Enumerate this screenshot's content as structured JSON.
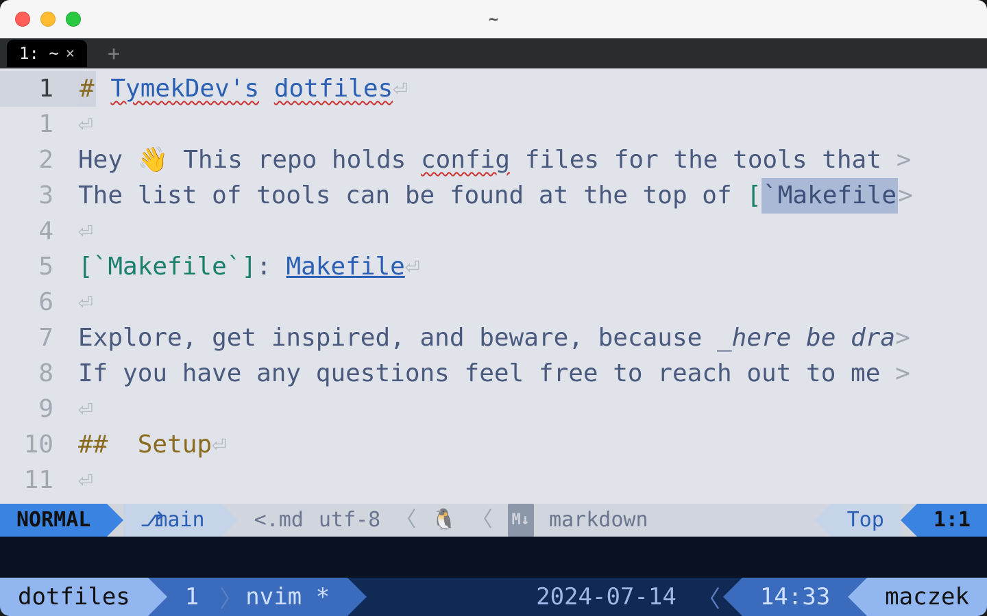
{
  "window": {
    "title": "~"
  },
  "termtabs": {
    "active": {
      "label": "1: ~",
      "close": "×"
    },
    "newtab_glyph": "+"
  },
  "editor": {
    "lines": [
      {
        "gutter": "1",
        "current": true
      },
      {
        "gutter": "1"
      },
      {
        "gutter": "2"
      },
      {
        "gutter": "3"
      },
      {
        "gutter": "4"
      },
      {
        "gutter": "5"
      },
      {
        "gutter": "6"
      },
      {
        "gutter": "7"
      },
      {
        "gutter": "8"
      },
      {
        "gutter": "9"
      },
      {
        "gutter": "10"
      },
      {
        "gutter": "11"
      }
    ],
    "content": {
      "h1_hash": "#",
      "h1_word1": "TymekDev's",
      "h1_word2": "dotfiles",
      "eol": "⏎",
      "l2_pre": "Hey 👋 This repo holds ",
      "l2_mid": "config",
      "l2_post": " files for the tools that ",
      "trail": ">",
      "l3_pre": "The list of tools can be found at the top of ",
      "l3_brk": "[",
      "l3_code": "`Makefile",
      "l5_a": "[`Makefile`]",
      "l5_colon": ": ",
      "l5_link": "Makefile",
      "l7_pre": "Explore, get inspired, and beware, because ",
      "l7_em": "_here be dra",
      "l8": "If you have any questions feel free to reach out to me ",
      "h2_hash": "##",
      "h2_text": "  Setup"
    }
  },
  "vimstatus": {
    "mode": "NORMAL",
    "branch_icon": "⎇",
    "branch": "main",
    "fileext": "<.md",
    "encoding": "utf-8",
    "os_icon": "🐧",
    "md_badge": "M↓",
    "filetype": "markdown",
    "scroll": "Top",
    "pos": "1:1"
  },
  "tmux": {
    "session": "dotfiles",
    "window_index": "1",
    "window_name": "nvim *",
    "date": "2024-07-14",
    "time": "14:33",
    "host": "maczek"
  }
}
